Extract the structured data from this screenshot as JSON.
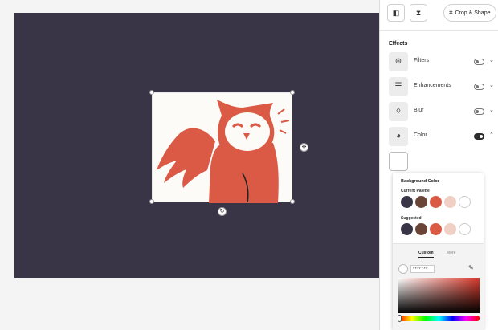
{
  "toolbar": {
    "flip_horizontal_icon": "flip-horizontal-icon",
    "flip_vertical_icon": "flip-vertical-icon",
    "crop_label": "Crop & Shape"
  },
  "effects": {
    "title": "Effects",
    "items": [
      {
        "label": "Filters",
        "icon": "filters-icon",
        "enabled": false,
        "expanded": false
      },
      {
        "label": "Enhancements",
        "icon": "sliders-icon",
        "enabled": false,
        "expanded": false
      },
      {
        "label": "Blur",
        "icon": "droplet-icon",
        "enabled": false,
        "expanded": false
      },
      {
        "label": "Color",
        "icon": "palette-icon",
        "enabled": true,
        "expanded": true
      }
    ]
  },
  "colors": {
    "canvas_bg": "#393446",
    "owl": "#db5a45",
    "selected_background": "#FFFFFF"
  },
  "background_color": {
    "title": "Background Color",
    "current_palette_label": "Current Palette",
    "current_palette": [
      "#393446",
      "#6b4438",
      "#db5a45",
      "#f0cfc5",
      "#ffffff"
    ],
    "suggested_label": "Suggested",
    "suggested": [
      "#393446",
      "#6b4438",
      "#db5a45",
      "#f0cfc5",
      "#ffffff"
    ],
    "tabs": [
      "Custom",
      "More"
    ],
    "active_tab": "Custom",
    "hex_value": "#FFFFFF",
    "eyedropper_icon": "eyedropper-icon"
  }
}
